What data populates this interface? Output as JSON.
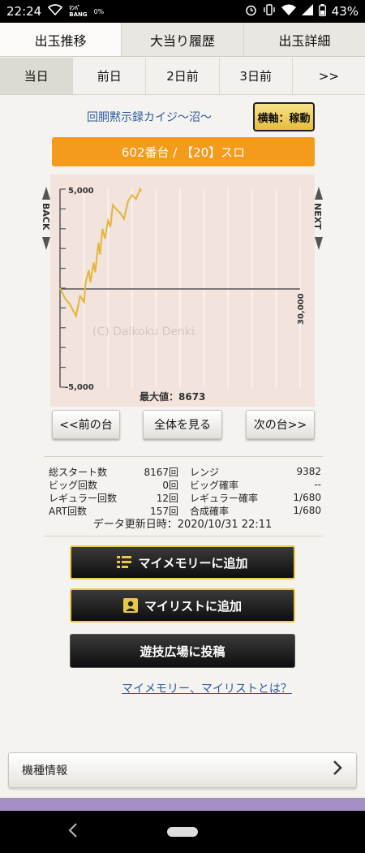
{
  "status": {
    "time": "22:24",
    "badge_top": "ﾏﾝﾊﾞ",
    "badge_bottom": "BANG",
    "data_pct": "0%",
    "battery": "43%"
  },
  "tabs_main": [
    {
      "label": "出玉推移"
    },
    {
      "label": "大当り履歴"
    },
    {
      "label": "出玉詳細"
    }
  ],
  "tabs_day": [
    {
      "label": "当日"
    },
    {
      "label": "前日"
    },
    {
      "label": "2日前"
    },
    {
      "label": "3日前"
    },
    {
      "label": ">>"
    }
  ],
  "machine": {
    "name": "回胴黙示録カイジ～沼～",
    "axis_button": "横軸：稼動",
    "banner": "602番台 / 【20】スロ"
  },
  "chart_data": {
    "type": "line",
    "y_ticks": [
      "5,000",
      "-5,000"
    ],
    "x_tick": "30,000",
    "ylim": [
      -5000,
      5000
    ],
    "xlim": [
      0,
      30000
    ],
    "watermark": "(C) Daikoku Denki.",
    "max_label": "最大値：8673",
    "side_left": "BACK",
    "side_right": "NEXT",
    "x": [
      0,
      600,
      1200,
      2000,
      2500,
      3000,
      3200,
      3600,
      3800,
      4200,
      4400,
      4800,
      5000,
      5300,
      5600,
      6000,
      6300,
      6600,
      7000,
      7500,
      8000,
      8500,
      9000,
      9500,
      10000,
      10167
    ],
    "y": [
      0,
      -500,
      -800,
      -1400,
      -400,
      -700,
      300,
      900,
      300,
      1300,
      800,
      2300,
      1700,
      3000,
      2500,
      3400,
      3100,
      4200,
      4000,
      3800,
      3500,
      4400,
      4700,
      4500,
      5000,
      4900
    ],
    "accent_color": "#e2b63a"
  },
  "nav_buttons": {
    "prev": "<<前の台",
    "all": "全体を見る",
    "next": "次の台>>"
  },
  "stats": {
    "rows": [
      {
        "l1": "総スタート数",
        "v1": "8167回",
        "l2": "レンジ",
        "v2": "9382"
      },
      {
        "l1": "ビッグ回数",
        "v1": "0回",
        "l2": "ビッグ確率",
        "v2": "--"
      },
      {
        "l1": "レギュラー回数",
        "v1": "12回",
        "l2": "レギュラー確率",
        "v2": "1/680"
      },
      {
        "l1": "ART回数",
        "v1": "157回",
        "l2": "合成確率",
        "v2": "1/680"
      }
    ],
    "updated": "データ更新日時：2020/10/31 22:11"
  },
  "actions": {
    "memory": "マイメモリーに追加",
    "mylist": "マイリストに追加",
    "post": "遊技広場に投稿",
    "faq": "マイメモリー、マイリストとは？"
  },
  "info": {
    "label": "機種情報"
  },
  "colors": {
    "orange": "#f59b1b",
    "gold": "#e8c74a",
    "link": "#2b5aa0"
  }
}
